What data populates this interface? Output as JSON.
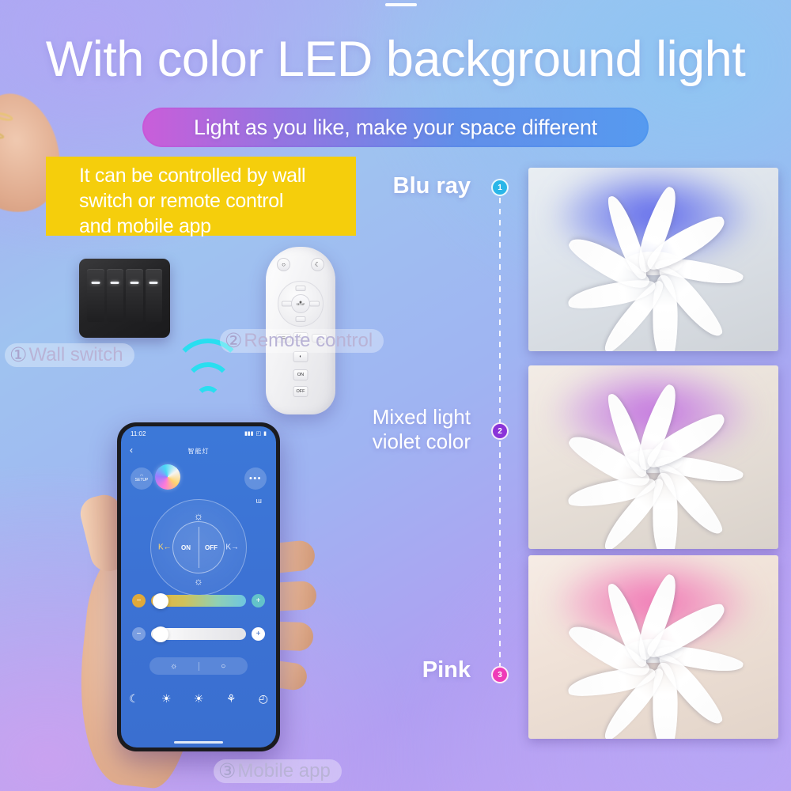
{
  "headline": "With color LED background light",
  "subtitle": "Light as you like, make your space different",
  "yellow_callout": {
    "line1": "It can be controlled by wall",
    "line2": "switch or remote control",
    "line3": "and mobile app"
  },
  "control_methods": [
    {
      "number": "①",
      "label": "Wall switch"
    },
    {
      "number": "②",
      "label": "Remote control"
    },
    {
      "number": "③",
      "label": "Mobile app"
    }
  ],
  "colors": {
    "yellow_box": "#F5CE0C",
    "badge_blue": "#2AB6E8",
    "badge_violet": "#8A33D8",
    "badge_pink": "#EF3BB8",
    "app_background": "#3C78D8",
    "wifi_wave": "#23E0F0"
  },
  "light_modes": [
    {
      "badge": "1",
      "label": "Blu ray",
      "label_line2": ""
    },
    {
      "badge": "2",
      "label": "Mixed light",
      "label_line2": "violet color"
    },
    {
      "badge": "3",
      "label": "Pink",
      "label_line2": ""
    }
  ],
  "phone_app": {
    "status_time": "11:02",
    "status_location_icon": "➤",
    "status_signal_icon": "▮▮▮",
    "status_wifi_icon": "◰",
    "status_battery_icon": "▮",
    "back_icon": "‹",
    "title": "智能灯",
    "setup_label": "SETUP",
    "setup_icon": "◠",
    "more_icon": "•••",
    "mic_icon": "ᵚ",
    "dial": {
      "on_label": "ON",
      "off_label": "OFF",
      "sun_top_icon": "☼",
      "sun_bottom_icon": "☼",
      "kelvin_down": "K←",
      "kelvin_up": "K→"
    },
    "sliders": [
      {
        "minus": "−",
        "plus": "+",
        "name": "color-temperature"
      },
      {
        "minus": "−",
        "plus": "+",
        "name": "brightness"
      }
    ],
    "mode_pill": {
      "left_icon": "☼",
      "right_icon": "○"
    },
    "bottom_icons": [
      "☾",
      "☀",
      "☀",
      "⚘",
      "◴"
    ]
  },
  "remote": {
    "btn_bulb": "○",
    "btn_moon": "☾",
    "pad_center_icon": "◉",
    "pad_center_label": "SETUP",
    "btn_on": "ON",
    "btn_off": "OFF",
    "btn_contrast": "◐",
    "btn_night": "☾",
    "btn_up": "△",
    "btn_menu": "☰"
  },
  "wall_switch": {
    "gangs": 4,
    "brand": ""
  }
}
